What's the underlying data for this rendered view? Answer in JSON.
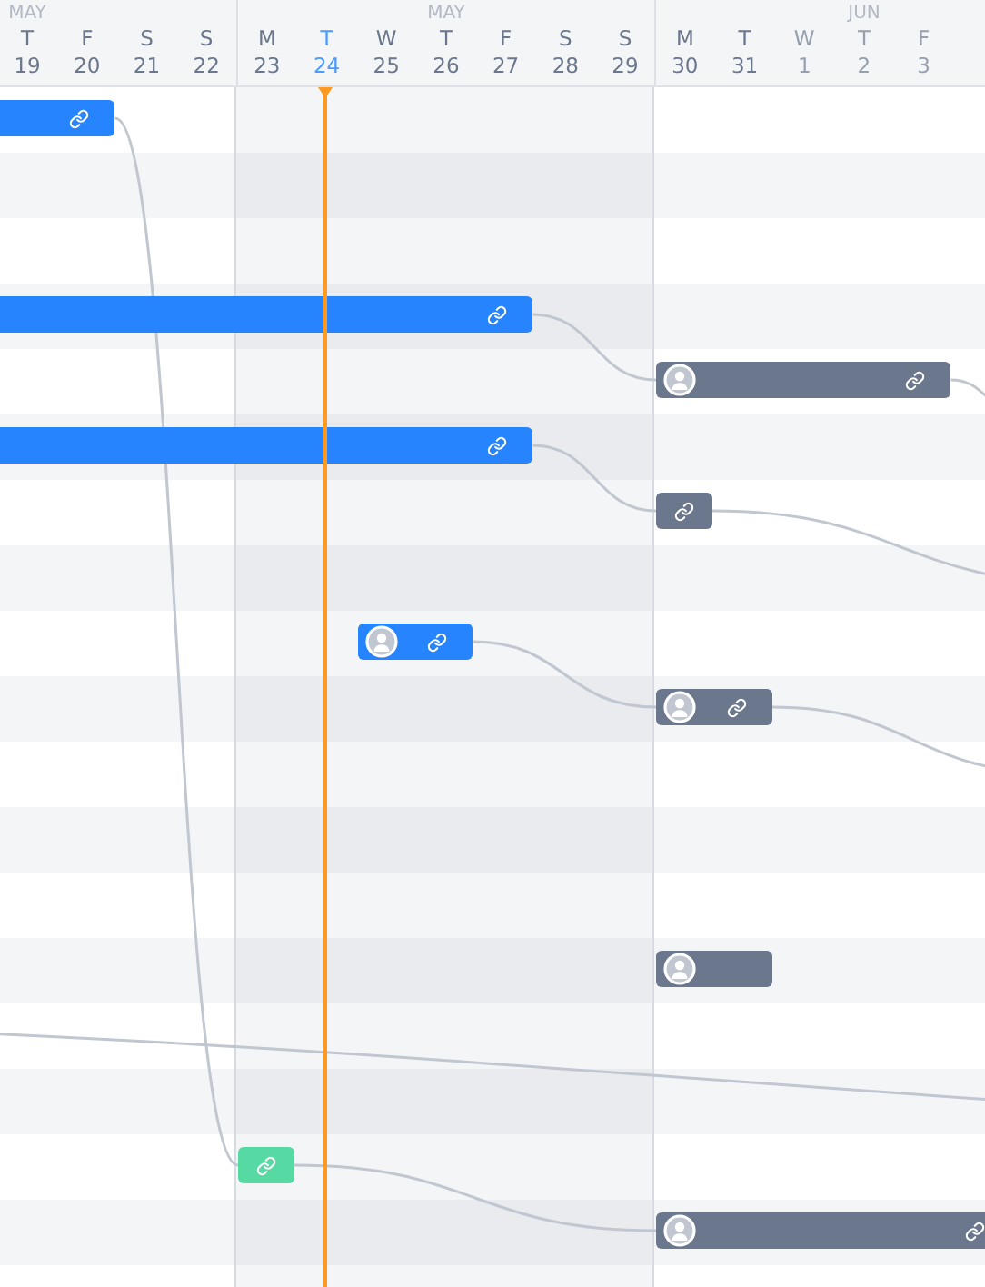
{
  "weeks": [
    {
      "month": "MAY",
      "current": false,
      "days": [
        {
          "weekday": "T",
          "day": "19",
          "today": false,
          "muted": false
        },
        {
          "weekday": "F",
          "day": "20",
          "today": false,
          "muted": false
        },
        {
          "weekday": "S",
          "day": "21",
          "today": false,
          "muted": false
        },
        {
          "weekday": "S",
          "day": "22",
          "today": false,
          "muted": false
        }
      ]
    },
    {
      "month": "MAY",
      "current": true,
      "days": [
        {
          "weekday": "M",
          "day": "23",
          "today": false,
          "muted": false
        },
        {
          "weekday": "T",
          "day": "24",
          "today": true,
          "muted": false
        },
        {
          "weekday": "W",
          "day": "25",
          "today": false,
          "muted": false
        },
        {
          "weekday": "T",
          "day": "26",
          "today": false,
          "muted": false
        },
        {
          "weekday": "F",
          "day": "27",
          "today": false,
          "muted": false
        },
        {
          "weekday": "S",
          "day": "28",
          "today": false,
          "muted": false
        },
        {
          "weekday": "S",
          "day": "29",
          "today": false,
          "muted": false
        }
      ]
    },
    {
      "month": "JUN",
      "current": false,
      "days": [
        {
          "weekday": "M",
          "day": "30",
          "today": false,
          "muted": false
        },
        {
          "weekday": "T",
          "day": "31",
          "today": false,
          "muted": false
        },
        {
          "weekday": "W",
          "day": "1",
          "today": false,
          "muted": true
        },
        {
          "weekday": "T",
          "day": "2",
          "today": false,
          "muted": true
        },
        {
          "weekday": "F",
          "day": "3",
          "today": false,
          "muted": true
        }
      ]
    }
  ],
  "rows": [
    {
      "task": {
        "color": "#2684ff",
        "avatar": false,
        "link": true
      }
    },
    {},
    {},
    {
      "task": {
        "color": "#2684ff",
        "avatar": false,
        "link": true
      }
    },
    {
      "task": {
        "color": "#6b778c",
        "avatar": true,
        "link": true
      }
    },
    {
      "task": {
        "color": "#2684ff",
        "avatar": false,
        "link": true
      }
    },
    {
      "task": {
        "color": "#6b778c",
        "avatar": false,
        "link": true
      }
    },
    {},
    {
      "task": {
        "color": "#2684ff",
        "avatar": true,
        "link": true
      }
    },
    {
      "task": {
        "color": "#6b778c",
        "avatar": true,
        "link": true
      }
    },
    {},
    {},
    {},
    {
      "task": {
        "color": "#6b778c",
        "avatar": true,
        "link": false
      }
    },
    {},
    {},
    {
      "task": {
        "color": "#57d9a3",
        "avatar": false,
        "link": true
      }
    },
    {
      "task": {
        "color": "#6b778c",
        "avatar": true,
        "link": true
      }
    },
    {}
  ]
}
